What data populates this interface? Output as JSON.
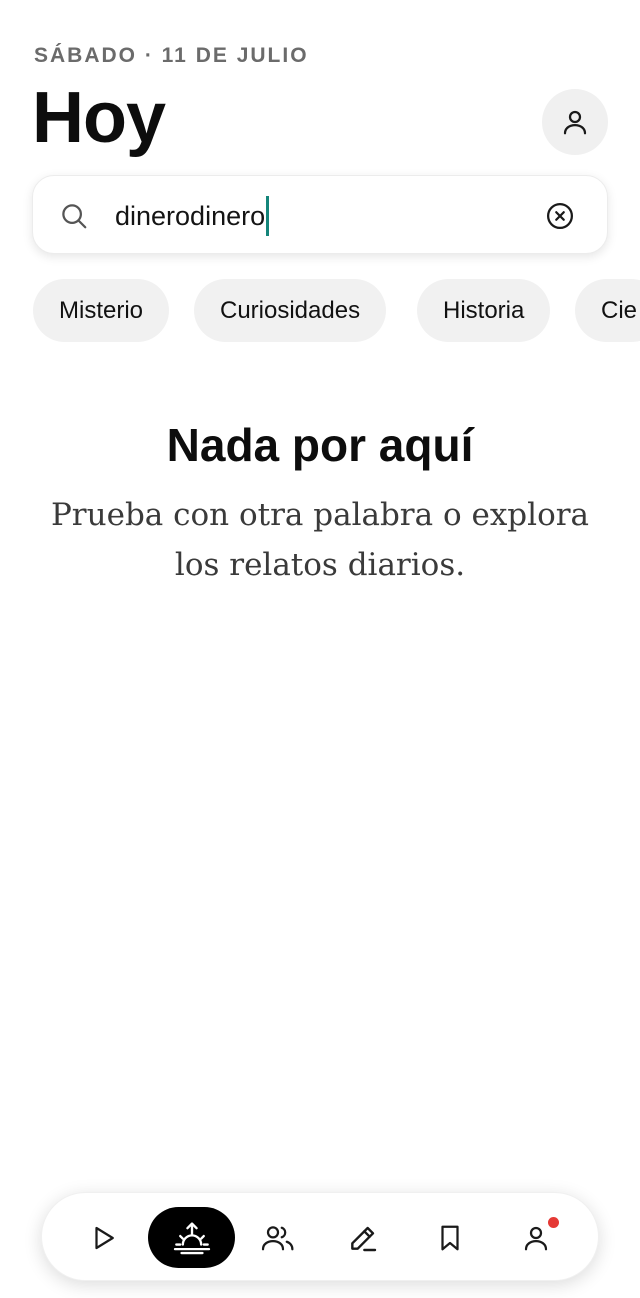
{
  "header": {
    "date": "SÁBADO · 11 DE JULIO",
    "title": "Hoy"
  },
  "search": {
    "value": "dinerodinero"
  },
  "chips": [
    {
      "label": "Misterio"
    },
    {
      "label": "Curiosidades"
    },
    {
      "label": "Historia"
    },
    {
      "label": "Cie"
    }
  ],
  "empty_state": {
    "title": "Nada por aquí",
    "description": "Prueba con otra palabra o explora los relatos diarios."
  },
  "tabbar": {
    "items": [
      {
        "icon": "play-icon",
        "active": false
      },
      {
        "icon": "sunrise-icon",
        "active": true
      },
      {
        "icon": "people-icon",
        "active": false
      },
      {
        "icon": "pencil-icon",
        "active": false
      },
      {
        "icon": "bookmark-icon",
        "active": false
      },
      {
        "icon": "profile-icon",
        "active": false,
        "notification": true
      }
    ]
  },
  "colors": {
    "accent_caret": "#14857a",
    "notification": "#e53935",
    "active_tab": "#000000"
  }
}
